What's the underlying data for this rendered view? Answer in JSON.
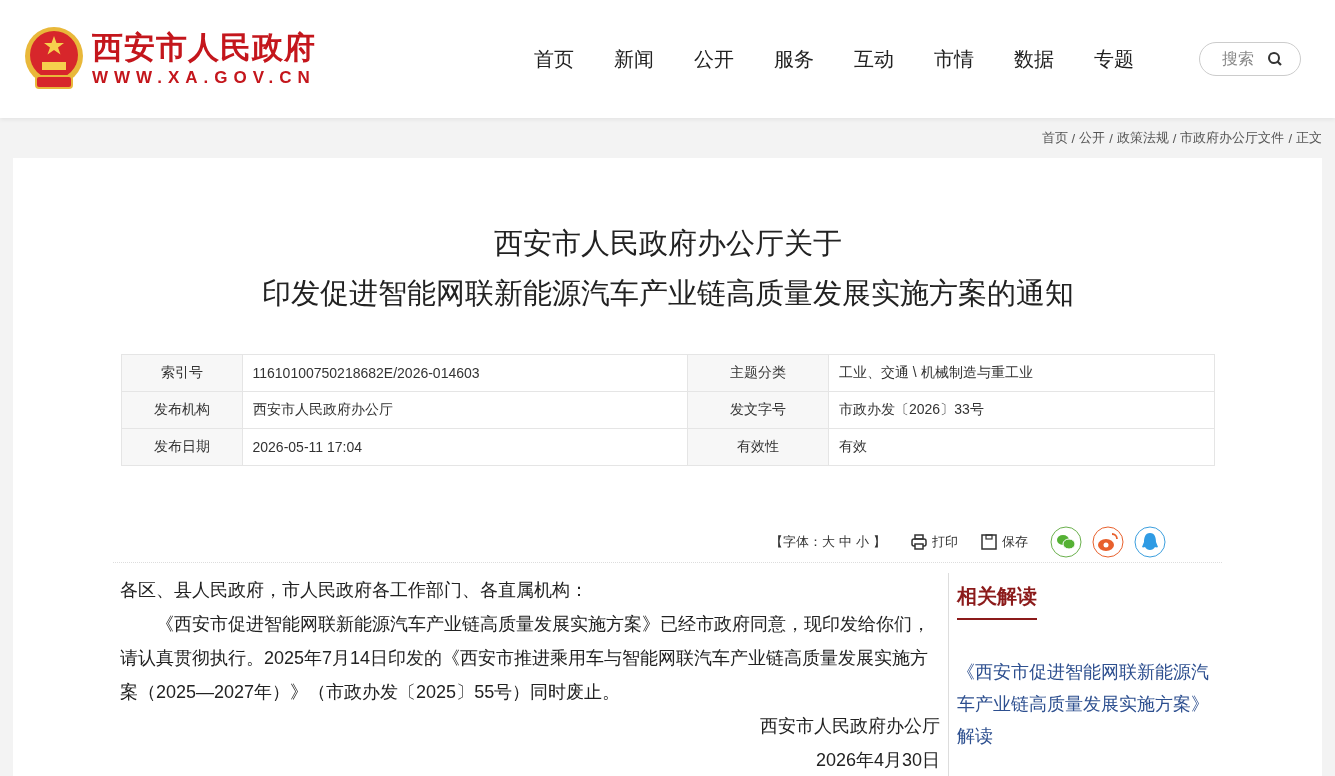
{
  "header": {
    "site_name": "西安市人民政府",
    "site_url": "WWW.XA.GOV.CN",
    "nav": [
      "首页",
      "新闻",
      "公开",
      "服务",
      "互动",
      "市情",
      "数据",
      "专题"
    ],
    "search": {
      "placeholder": "搜索"
    }
  },
  "breadcrumb": {
    "separator": "/",
    "items": [
      "首页",
      "公开",
      "政策法规",
      "市政府办公厅文件",
      "正文"
    ]
  },
  "title": [
    "西安市人民政府办公厅关于",
    "印发促进智能网联新能源汽车产业链高质量发展实施方案的通知"
  ],
  "meta": [
    {
      "label_1": "索引号",
      "value_1": "11610100750218682E/2026-014603",
      "label_2": "主题分类",
      "value_2": "工业、交通 \\ 机械制造与重工业"
    },
    {
      "label_1": "发布机构",
      "value_1": "西安市人民政府办公厅",
      "label_2": "发文字号",
      "value_2": "市政办发〔2026〕33号"
    },
    {
      "label_1": "发布日期",
      "value_1": "2026-05-11 17:04",
      "label_2": "有效性",
      "value_2": "有效"
    }
  ],
  "tools": {
    "font_prefix": "【字体：",
    "sizes": [
      "大",
      "中",
      "小"
    ],
    "font_suffix": "】",
    "print": "打印",
    "save": "保存"
  },
  "body": {
    "salutation": "各区、县人民政府，市人民政府各工作部门、各直属机构：",
    "paragraphs": [
      "《西安市促进智能网联新能源汽车产业链高质量发展实施方案》已经市政府同意，现印发给你们，请认真贯彻执行。2025年7月14日印发的《西安市推进乘用车与智能网联汽车产业链高质量发展实施方案（2025—2027年）》（市政办发〔2025〕55号）同时废止。"
    ],
    "signature": [
      "西安市人民政府办公厅",
      "2026年4月30日"
    ]
  },
  "sidebar": {
    "heading": "相关解读",
    "links": [
      "《西安市促进智能网联新能源汽车产业链高质量发展实施方案》解读"
    ]
  }
}
